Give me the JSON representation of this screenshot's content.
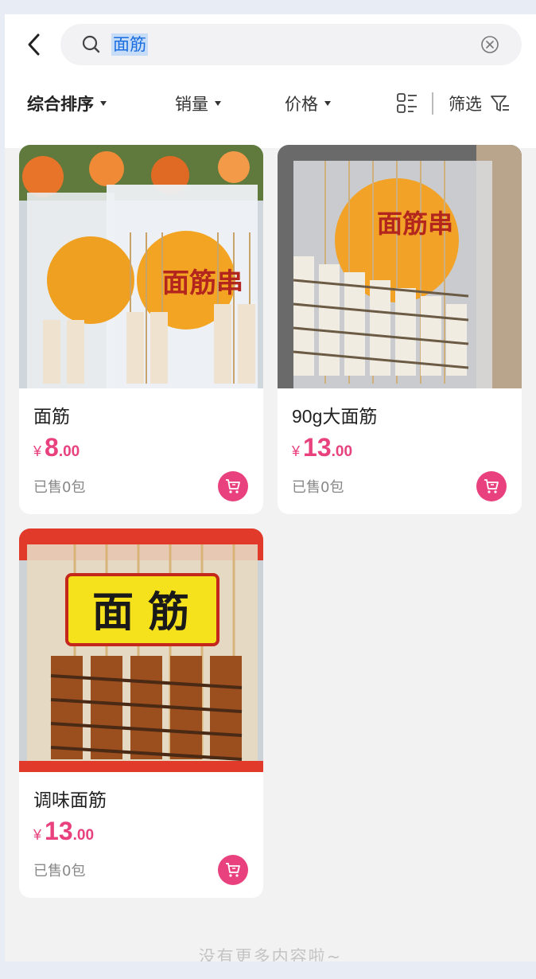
{
  "search": {
    "query": "面筋"
  },
  "sort": {
    "items": [
      {
        "label": "综合排序",
        "active": true
      },
      {
        "label": "销量",
        "active": false
      },
      {
        "label": "价格",
        "active": false
      }
    ],
    "filter_label": "筛选"
  },
  "products": [
    {
      "name": "面筋",
      "currency": "¥",
      "price_int": "8",
      "price_dec": ".00",
      "sold": "已售0包",
      "image_text": "面筋串"
    },
    {
      "name": "90g大面筋",
      "currency": "¥",
      "price_int": "13",
      "price_dec": ".00",
      "sold": "已售0包",
      "image_text": "面筋串"
    },
    {
      "name": "调味面筋",
      "currency": "¥",
      "price_int": "13",
      "price_dec": ".00",
      "sold": "已售0包",
      "image_text": "面 筋"
    }
  ],
  "footer_tip": "没有更多内容啦~",
  "colors": {
    "accent": "#e8417e",
    "background": "#f2f2f2"
  }
}
